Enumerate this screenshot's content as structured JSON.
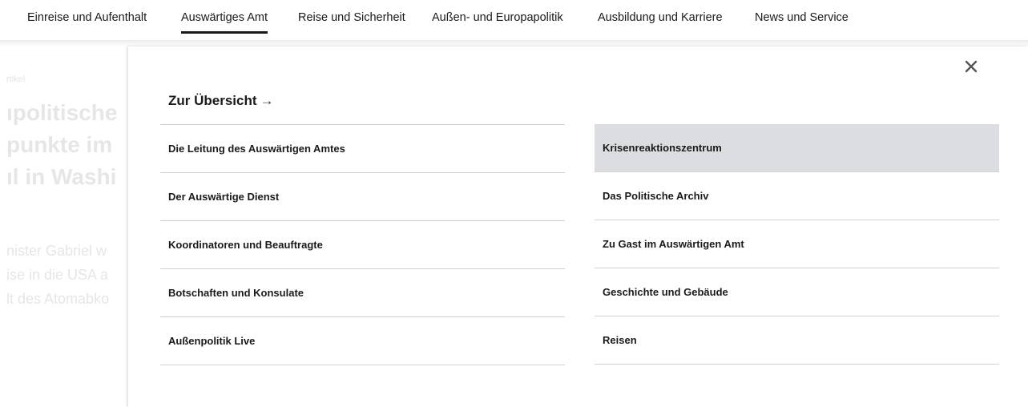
{
  "topnav": {
    "items": [
      {
        "label": "Einreise und Aufenthalt"
      },
      {
        "label": "Auswärtiges Amt"
      },
      {
        "label": "Reise und Sicherheit"
      },
      {
        "label": "Außen- und Europapolitik"
      },
      {
        "label": "Ausbildung und Karriere"
      },
      {
        "label": "News und Service"
      }
    ],
    "active_index": 1
  },
  "background": {
    "kicker": "rtikel",
    "headline_lines": [
      "ıpolitische",
      "punkte im",
      "ıl in Washi"
    ],
    "teaser_lines": [
      "nister Gabriel w",
      "ise in die USA a",
      "lt des Atomabko"
    ]
  },
  "panel": {
    "close_icon": "close-icon",
    "overview_label": "Zur Übersicht",
    "overview_arrow": "→",
    "left_items": [
      {
        "label": "Die Leitung des Auswärtigen Amtes"
      },
      {
        "label": "Der Auswärtige Dienst"
      },
      {
        "label": "Koordinatoren und Beauftragte"
      },
      {
        "label": "Botschaften und Konsulate"
      },
      {
        "label": "Außenpolitik Live"
      }
    ],
    "right_items": [
      {
        "label": "Krisenreaktionszentrum",
        "hovered": true
      },
      {
        "label": "Das Politische Archiv"
      },
      {
        "label": "Zu Gast im Auswärtigen Amt"
      },
      {
        "label": "Geschichte und Gebäude"
      },
      {
        "label": "Reisen"
      }
    ]
  },
  "colors": {
    "text": "#1a1a1a",
    "divider": "#d0d0d0",
    "hover_bg": "#dcdde0",
    "faded_text": "#e6e6e6"
  }
}
